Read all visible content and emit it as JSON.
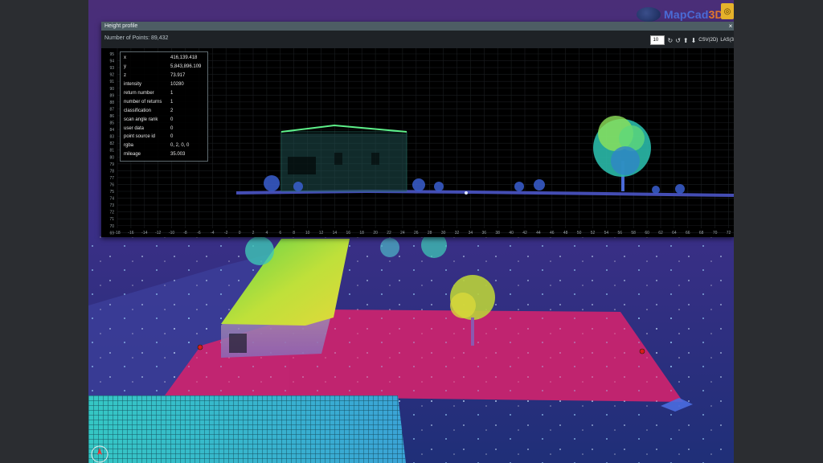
{
  "brand": {
    "name_part1": "MapCad",
    "name_part2": "3D",
    "button_icon": "settings-icon"
  },
  "panel": {
    "title": "Height profile",
    "close_label": "×",
    "points_label": "Number of Points:",
    "points_value": "89,432",
    "toolbar": {
      "point_size": "10",
      "rotate_left_icon": "rotate-ccw-icon",
      "rotate_right_icon": "rotate-cw-icon",
      "upload_icon": "upload-icon",
      "download_icon": "download-icon",
      "csv_label": "CSV(2D)",
      "las_label": "LAS(3"
    }
  },
  "profile": {
    "y_ticks": [
      "95",
      "94",
      "93",
      "92",
      "91",
      "90",
      "89",
      "88",
      "87",
      "86",
      "85",
      "84",
      "83",
      "82",
      "81",
      "80",
      "79",
      "78",
      "77",
      "76",
      "75",
      "74",
      "73",
      "72",
      "71",
      "70",
      "69"
    ],
    "x_ticks": [
      "-18",
      "-16",
      "-14",
      "-12",
      "-10",
      "-8",
      "-6",
      "-4",
      "-2",
      "0",
      "2",
      "4",
      "6",
      "8",
      "10",
      "12",
      "14",
      "16",
      "18",
      "20",
      "22",
      "24",
      "26",
      "28",
      "30",
      "32",
      "34",
      "36",
      "38",
      "40",
      "42",
      "44",
      "46",
      "48",
      "50",
      "52",
      "54",
      "56",
      "58",
      "60",
      "62",
      "64",
      "66",
      "68",
      "70",
      "72",
      "74"
    ]
  },
  "point_info": [
    {
      "key": "x",
      "value": "416,139.418"
    },
    {
      "key": "y",
      "value": "5,843,896.109"
    },
    {
      "key": "z",
      "value": "73.917"
    },
    {
      "key": "intensity",
      "value": "10280"
    },
    {
      "key": "return number",
      "value": "1"
    },
    {
      "key": "number of returns",
      "value": "1"
    },
    {
      "key": "classification",
      "value": "2"
    },
    {
      "key": "scan angle rank",
      "value": "0"
    },
    {
      "key": "user data",
      "value": "0"
    },
    {
      "key": "point source id",
      "value": "0"
    },
    {
      "key": "rgba",
      "value": "0, 2, 0, 0"
    },
    {
      "key": "mileage",
      "value": "35.003"
    }
  ],
  "scene": {
    "compass_icon": "compass-icon",
    "profile_marker_color": "#d81b1b",
    "selection_color": "#d8246e"
  }
}
